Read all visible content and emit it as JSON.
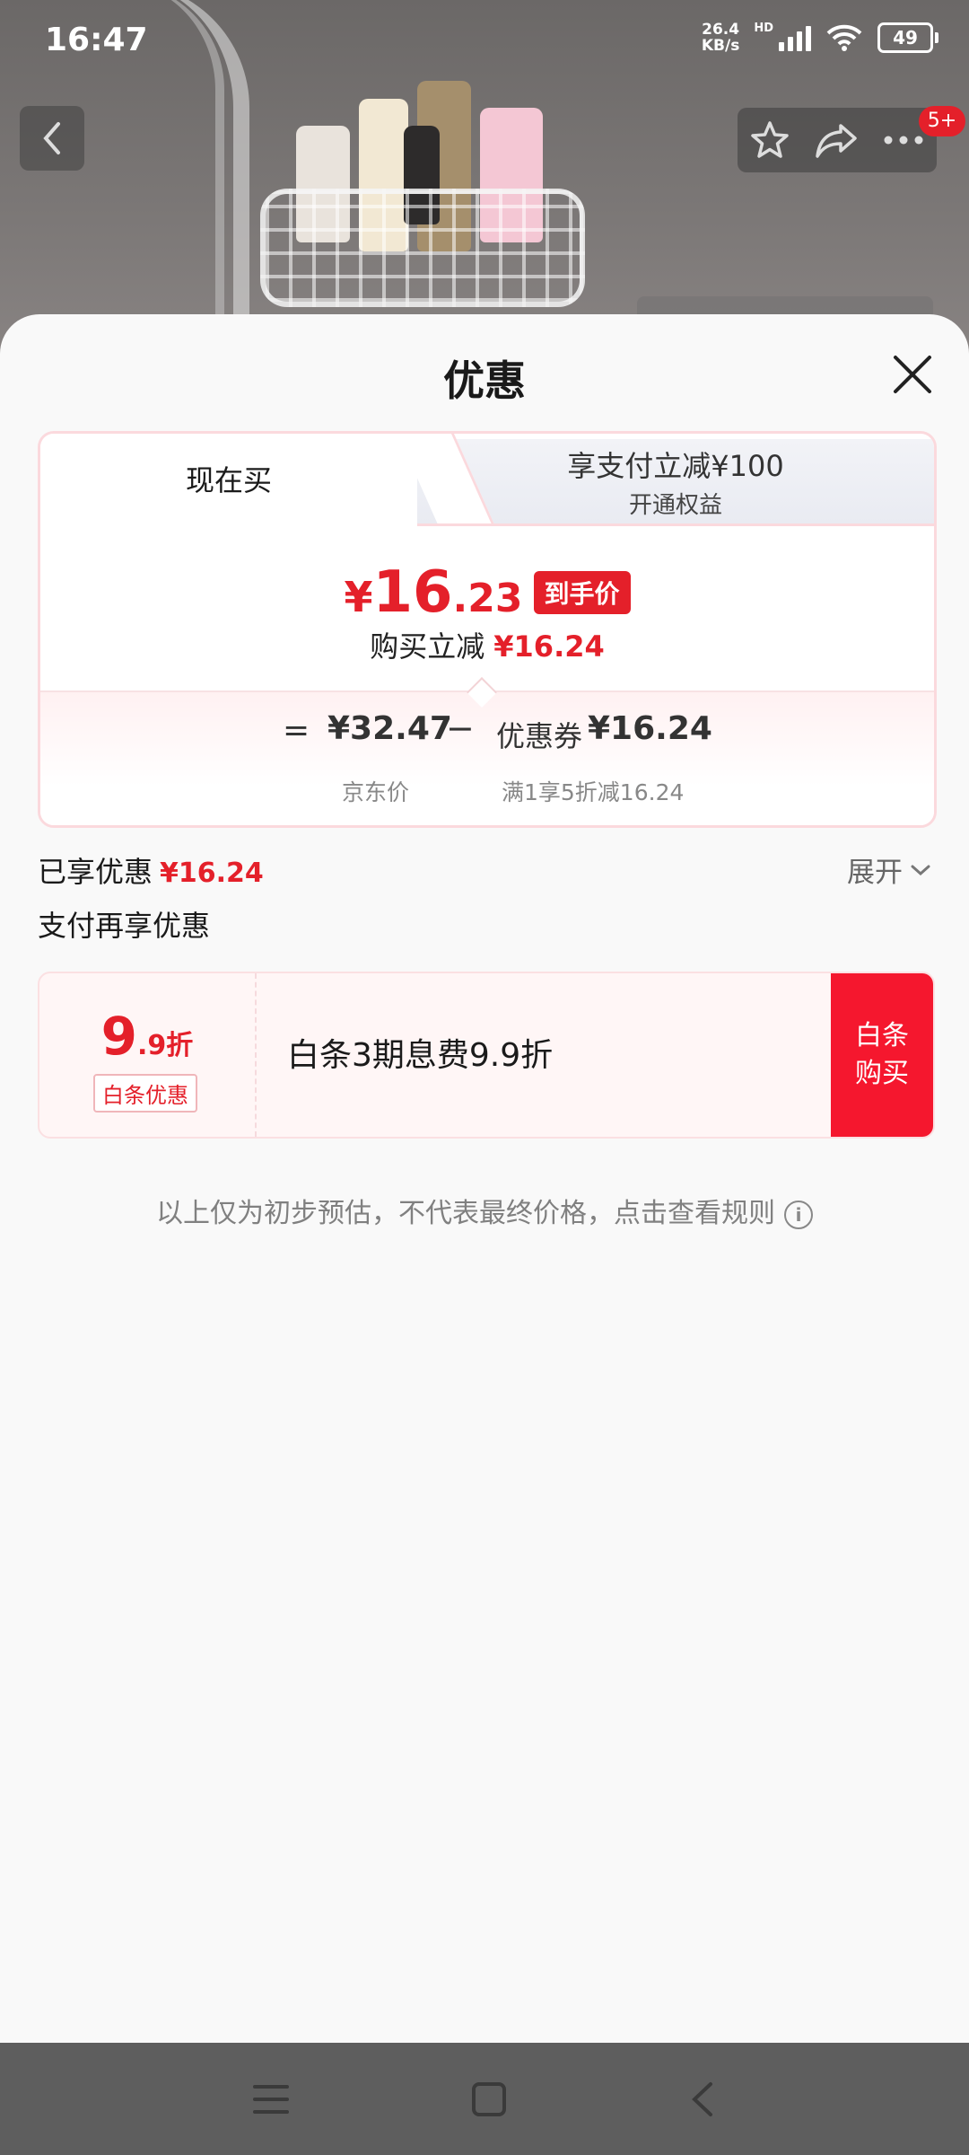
{
  "status_bar": {
    "time": "16:47",
    "net_speed_value": "26.4",
    "net_speed_unit": "KB/s",
    "hd_label": "HD",
    "battery": "49"
  },
  "top_nav": {
    "badge": "5+"
  },
  "sheet": {
    "title": "优惠",
    "tabs": [
      {
        "label": "现在买",
        "active": true
      },
      {
        "label": "享支付立减¥100",
        "sub": "开通权益",
        "active": false
      }
    ],
    "final_price": {
      "currency": "¥",
      "integer": "16",
      "decimal": ".23",
      "tag": "到手价"
    },
    "instant_discount": {
      "label": "购买立减",
      "value": "¥16.24"
    },
    "formula": {
      "equals": "=",
      "jd_price": "¥32.47",
      "minus": "−",
      "coupon_label": "优惠券",
      "coupon_value": "¥16.24",
      "jd_price_label": "京东价",
      "coupon_desc": "满1享5折减16.24"
    },
    "enjoyed": {
      "label": "已享优惠",
      "value": "¥16.24",
      "expand_label": "展开"
    },
    "pay_more_title": "支付再享优惠",
    "baitiao": {
      "discount_big": "9",
      "discount_small": ".9折",
      "tag": "白条优惠",
      "description": "白条3期息费9.9折",
      "buy_line1": "白条",
      "buy_line2": "购买"
    },
    "disclaimer": "以上仅为初步预估，不代表最终价格，点击查看规则"
  },
  "colors": {
    "accent_red": "#e4202a",
    "buy_red": "#f5172e",
    "sheet_bg": "#f9f9f9"
  }
}
